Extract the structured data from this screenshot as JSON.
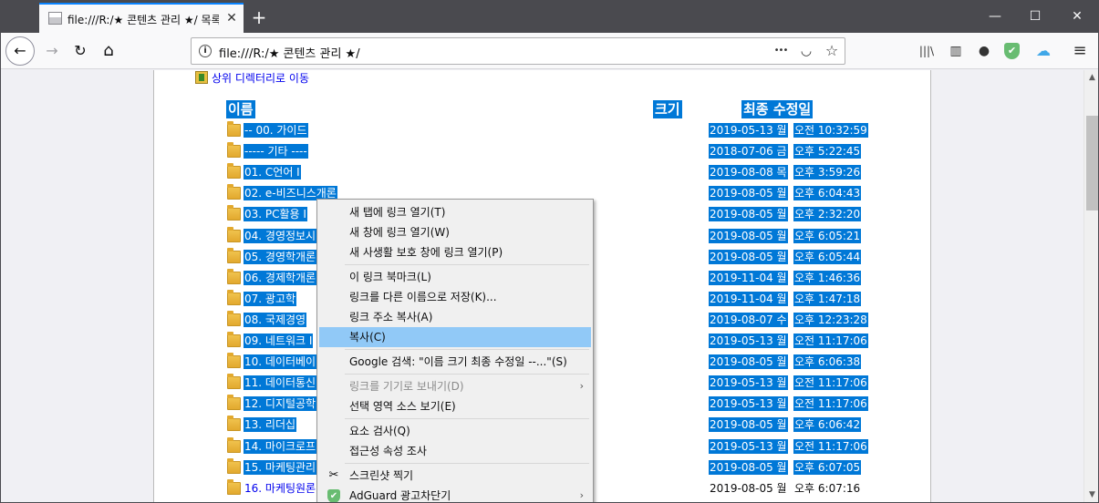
{
  "tab": {
    "title": "file:///R:/★ 콘텐츠 관리 ★/ 목록",
    "close": "✕"
  },
  "newtab": "+",
  "window_controls": {
    "minimize": "—",
    "maximize": "☐",
    "close": "✕"
  },
  "nav": {
    "back": "←",
    "forward": "→",
    "reload": "↻",
    "home": "⌂"
  },
  "urlbar": {
    "info": "i",
    "url": "file:///R:/★ 콘텐츠 관리 ★/",
    "more": "•••",
    "pocket": "◡",
    "bookmark": "☆"
  },
  "toolbar_icons": {
    "library": "|||\\",
    "sidebar": "▥",
    "account": "●",
    "adguard": "✔",
    "cloud": "☁",
    "menu": "≡"
  },
  "colors": {
    "selection": "#0078d7",
    "link": "#0000ee",
    "menu_highlight": "#91c9f7",
    "adguard": "#68bc71",
    "cloud": "#3fa7e8"
  },
  "listing": {
    "up_link": "상위 디렉터리로 이동",
    "headers": {
      "name": "이름",
      "size": "크기",
      "modified": "최종 수정일"
    },
    "rows": [
      {
        "name": "-- 00. 가이드",
        "date": "2019-05-13 월",
        "time": "오전 10:32:59",
        "selected": true
      },
      {
        "name": "----- 기타 ----",
        "date": "2018-07-06 금",
        "time": "오후 5:22:45",
        "selected": true
      },
      {
        "name": "01. C언어 I",
        "date": "2019-08-08 목",
        "time": "오후 3:59:26",
        "selected": true
      },
      {
        "name": "02. e-비즈니스개론",
        "date": "2019-08-05 월",
        "time": "오후 6:04:43",
        "selected": true
      },
      {
        "name": "03. PC활용 I",
        "date": "2019-08-05 월",
        "time": "오후 2:32:20",
        "selected": true
      },
      {
        "name": "04. 경영정보시",
        "date": "2019-08-05 월",
        "time": "오후 6:05:21",
        "selected": true
      },
      {
        "name": "05. 경영학개론",
        "date": "2019-08-05 월",
        "time": "오후 6:05:44",
        "selected": true
      },
      {
        "name": "06. 경제학개론",
        "date": "2019-11-04 월",
        "time": "오후 1:46:36",
        "selected": true
      },
      {
        "name": "07. 광고학",
        "date": "2019-11-04 월",
        "time": "오후 1:47:18",
        "selected": true
      },
      {
        "name": "08. 국제경영",
        "date": "2019-08-07 수",
        "time": "오후 12:23:28",
        "selected": true
      },
      {
        "name": "09. 네트워크 I",
        "date": "2019-05-13 월",
        "time": "오전 11:17:06",
        "selected": true
      },
      {
        "name": "10. 데이터베이",
        "date": "2019-08-05 월",
        "time": "오후 6:06:38",
        "selected": true
      },
      {
        "name": "11. 데이터통신",
        "date": "2019-05-13 월",
        "time": "오전 11:17:06",
        "selected": true
      },
      {
        "name": "12. 디지털공학",
        "date": "2019-05-13 월",
        "time": "오전 11:17:06",
        "selected": true
      },
      {
        "name": "13. 리더십",
        "date": "2019-08-05 월",
        "time": "오후 6:06:42",
        "selected": true
      },
      {
        "name": "14. 마이크로프",
        "date": "2019-05-13 월",
        "time": "오전 11:17:06",
        "selected": true
      },
      {
        "name": "15. 마케팅관리",
        "date": "2019-08-05 월",
        "time": "오후 6:07:05",
        "selected": true
      },
      {
        "name": "16. 마케팅원론",
        "date": "2019-08-05 월",
        "time": "오후 6:07:16",
        "selected": false
      }
    ]
  },
  "context_menu": {
    "items": [
      {
        "label": "새 탭에 링크 열기(T)"
      },
      {
        "label": "새 창에 링크 열기(W)"
      },
      {
        "label": "새 사생활 보호 창에 링크 열기(P)"
      },
      {
        "label": "이 링크 북마크(L)"
      },
      {
        "label": "링크를 다른 이름으로 저장(K)..."
      },
      {
        "label": "링크 주소 복사(A)"
      },
      {
        "label": "복사(C)"
      },
      {
        "label": "Google 검색: \"이름 크기 최종 수정일 --...\"(S)"
      },
      {
        "label": "링크를 기기로 보내기(D)"
      },
      {
        "label": "선택 영역 소스 보기(E)"
      },
      {
        "label": "요소 검사(Q)"
      },
      {
        "label": "접근성 속성 조사"
      },
      {
        "label": "스크린샷 찍기"
      },
      {
        "label": "AdGuard 광고차단기"
      }
    ],
    "submenu_arrow": "›",
    "screenshot_icon": "✂",
    "adguard_icon": "✔"
  },
  "scrollbar": {
    "up": "▲",
    "down": "▼"
  }
}
